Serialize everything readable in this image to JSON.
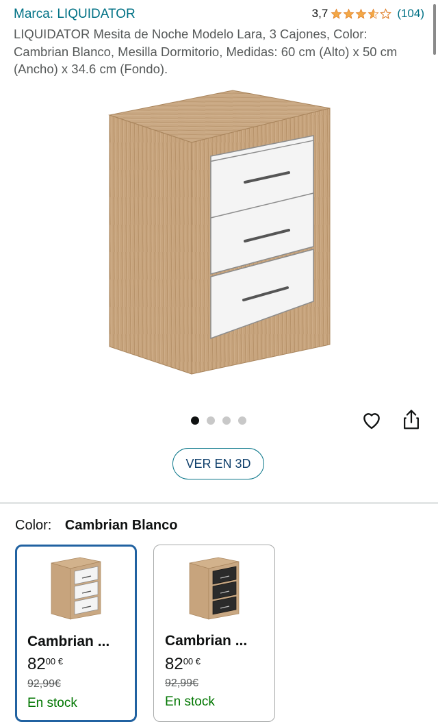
{
  "header": {
    "brand": "Marca: LIQUIDATOR",
    "rating_value": "3,7",
    "rating_stars": 3.7,
    "rating_count": "(104)",
    "title": "LIQUIDATOR Mesita de Noche Modelo Lara, 3 Cajones, Color: Cambrian Blanco, Mesilla Dormitorio, Medidas: 60 cm (Alto) x 50 cm (Ancho) x 34.6 cm (Fondo)."
  },
  "gallery": {
    "image_count": 4,
    "active_index": 0,
    "favorite_icon": "heart-icon",
    "share_icon": "share-icon",
    "view_3d_label": "VER EN 3D"
  },
  "variants": {
    "label": "Color:",
    "selected_value": "Cambrian Blanco",
    "options": [
      {
        "name": "Cambrian ...",
        "price_whole": "82",
        "price_fraction": "00 €",
        "old_price": "92,99€",
        "stock": "En stock",
        "drawer_color": "#f4f4f4",
        "selected": true
      },
      {
        "name": "Cambrian ...",
        "price_whole": "82",
        "price_fraction": "00 €",
        "old_price": "92,99€",
        "stock": "En stock",
        "drawer_color": "#2b2b2b",
        "selected": false
      }
    ]
  },
  "colors": {
    "link": "#007185",
    "star": "#f3a847",
    "selected_border": "#2162a1",
    "in_stock": "#007600"
  }
}
